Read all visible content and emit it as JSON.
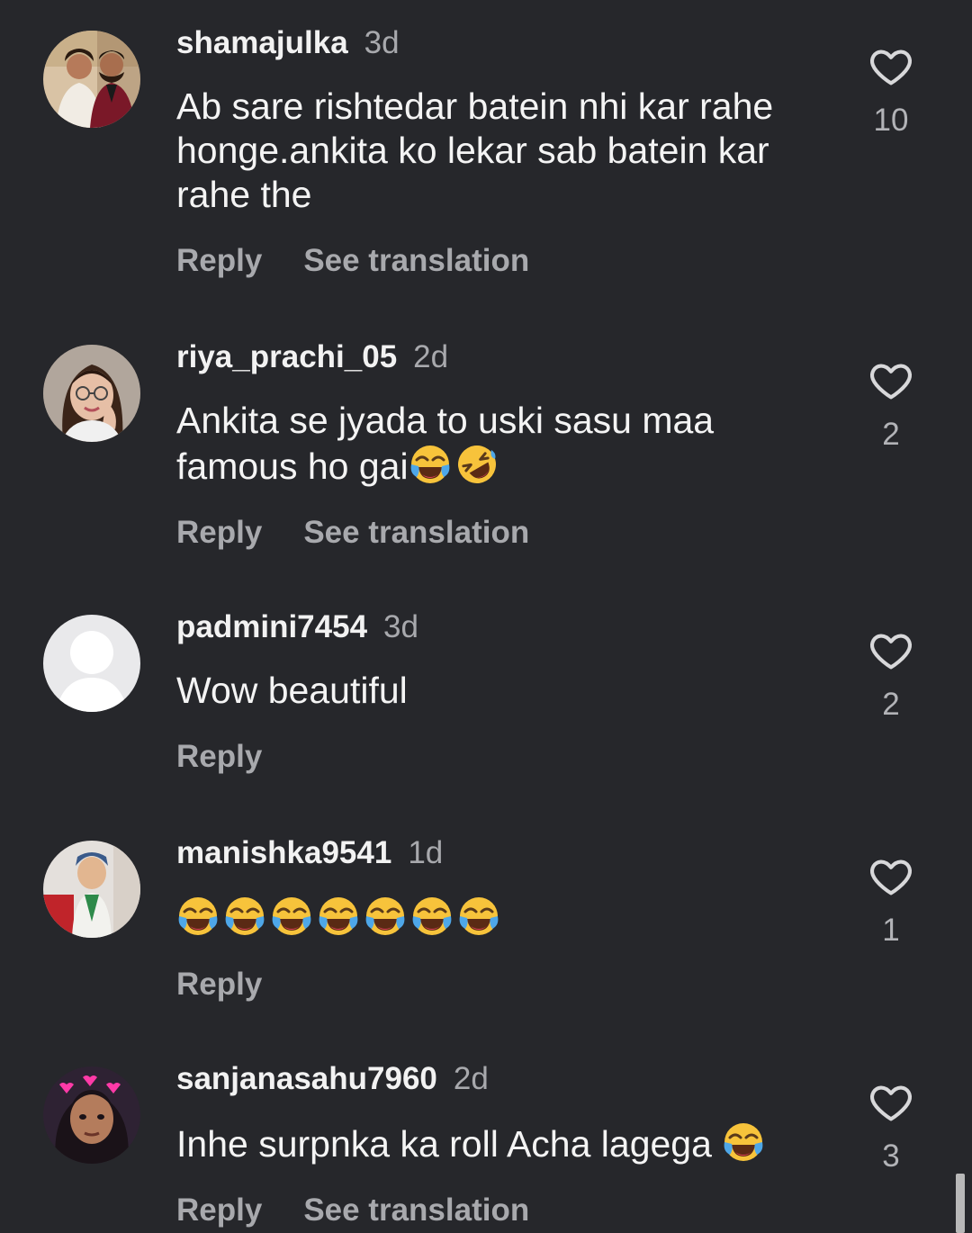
{
  "comments": [
    {
      "username": "shamajulka",
      "time": "3d",
      "text": "Ab sare rishtedar batein nhi kar rahe honge.ankita ko lekar sab batein kar rahe the",
      "reply_label": "Reply",
      "translate_label": "See translation",
      "likes": "10",
      "avatar": "couple-photo"
    },
    {
      "username": "riya_prachi_05",
      "time": "2d",
      "text": "Ankita se jyada to uski sasu maa famous ho gai",
      "emojis": [
        "face-with-tears-of-joy",
        "rolling-on-the-floor-laughing"
      ],
      "reply_label": "Reply",
      "translate_label": "See translation",
      "likes": "2",
      "avatar": "girl-photo"
    },
    {
      "username": "padmini7454",
      "time": "3d",
      "text": "Wow beautiful",
      "reply_label": "Reply",
      "likes": "2",
      "avatar": "default-avatar"
    },
    {
      "username": "manishka9541",
      "time": "1d",
      "emojis": [
        "face-with-tears-of-joy",
        "face-with-tears-of-joy",
        "face-with-tears-of-joy",
        "face-with-tears-of-joy",
        "face-with-tears-of-joy",
        "face-with-tears-of-joy",
        "face-with-tears-of-joy"
      ],
      "reply_label": "Reply",
      "likes": "1",
      "avatar": "child-photo"
    },
    {
      "username": "sanjanasahu7960",
      "time": "2d",
      "text": "Inhe surpnka ka roll Acha lagega",
      "emojis": [
        "face-with-tears-of-joy"
      ],
      "reply_label": "Reply",
      "translate_label": "See translation",
      "likes": "3",
      "avatar": "woman-photo"
    }
  ],
  "colors": {
    "background": "#26272b",
    "username": "#f2f2f2",
    "secondary_text": "#a8a9ad"
  }
}
